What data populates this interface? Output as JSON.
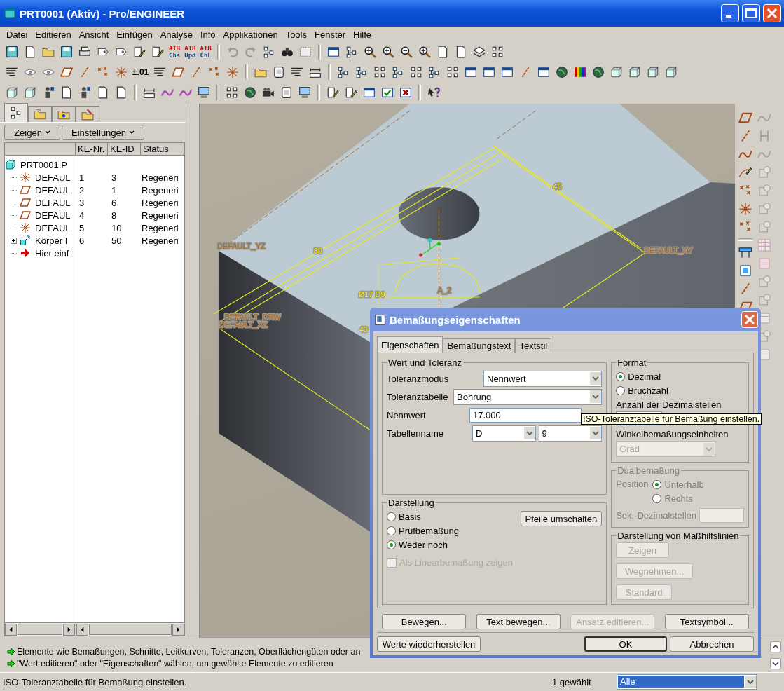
{
  "window": {
    "title": "PRT0001 (Aktiv) - Pro/ENGINEER"
  },
  "menu": [
    "Datei",
    "Editieren",
    "Ansicht",
    "Einfügen",
    "Analyse",
    "Info",
    "Applikationen",
    "Tools",
    "Fenster",
    "Hilfe"
  ],
  "toolbar_labels": [
    {
      "top": "ATB",
      "bottom": "Chs"
    },
    {
      "top": "ATB",
      "bottom": "Upd"
    },
    {
      "top": "ATB",
      "bottom": "ChL"
    },
    {
      "top": "±.01"
    }
  ],
  "model_tree": {
    "tabs": [
      {
        "selected": true
      },
      {
        "selected": false
      },
      {
        "selected": false
      },
      {
        "selected": false
      }
    ],
    "buttons": [
      "Zeigen",
      "Einstellungen"
    ],
    "columns": [
      "KE-Nr.",
      "KE-ID",
      "Status"
    ],
    "root": {
      "name": "PRT0001.P",
      "kind": "part",
      "children": [
        {
          "name": "DEFAUL",
          "kind": "csys",
          "nr": "1",
          "id": "3",
          "status": "Regeneri"
        },
        {
          "name": "DEFAUL",
          "kind": "plane",
          "nr": "2",
          "id": "1",
          "status": "Regeneri"
        },
        {
          "name": "DEFAUL",
          "kind": "plane",
          "nr": "3",
          "id": "6",
          "status": "Regeneri"
        },
        {
          "name": "DEFAUL",
          "kind": "plane",
          "nr": "4",
          "id": "8",
          "status": "Regeneri"
        },
        {
          "name": "DEFAUL",
          "kind": "csys",
          "nr": "5",
          "id": "10",
          "status": "Regeneri"
        },
        {
          "name": "Körper I",
          "kind": "body",
          "nr": "6",
          "id": "50",
          "status": "Regeneri",
          "expanded": false
        },
        {
          "name": "Hier einf",
          "kind": "insert"
        }
      ]
    }
  },
  "viewport": {
    "labels": [
      {
        "text": "DEFAULT_YZ",
        "kind": "datum"
      },
      {
        "text": "80",
        "kind": "dim"
      },
      {
        "text": "45",
        "kind": "dim"
      },
      {
        "text": "DEFAULT_XY",
        "kind": "datum"
      },
      {
        "text": "Ø17 D9",
        "kind": "dim"
      },
      {
        "text": "A_2",
        "kind": "datum"
      },
      {
        "text": "DEFAULT_DRW",
        "kind": "datum"
      },
      {
        "text": "DEFAULT_XZ",
        "kind": "datum"
      },
      {
        "text": "40",
        "kind": "dim"
      }
    ]
  },
  "dialog": {
    "title": "Bemaßungseigenschaften",
    "tabs": [
      {
        "label": "Eigenschaften",
        "selected": true
      },
      {
        "label": "Bemaßungstext",
        "selected": false
      },
      {
        "label": "Textstil",
        "selected": false
      }
    ],
    "value_group": {
      "title": "Wert und Toleranz",
      "fields": [
        {
          "label": "Toleranzmodus",
          "kind": "dropdown",
          "value": "Nennwert"
        },
        {
          "label": "Toleranztabelle",
          "kind": "dropdown-wide",
          "value": "Bohrung"
        },
        {
          "label": "Nennwert",
          "kind": "text",
          "value": "17.000"
        },
        {
          "label": "Tabellenname",
          "kind": "pair",
          "values": [
            "D",
            "9"
          ]
        }
      ]
    },
    "display_group": {
      "title": "Darstellung",
      "options": [
        {
          "label": "Basis",
          "selected": false
        },
        {
          "label": "Prüfbemaßung",
          "selected": false
        },
        {
          "label": "Weder noch",
          "selected": true
        }
      ],
      "button": "Pfeile umschalten",
      "checkbox": {
        "label": "Als Linearbemaßung zeigen",
        "checked": false,
        "disabled": true
      }
    },
    "format_group": {
      "title": "Format",
      "options": [
        {
          "label": "Dezimal",
          "selected": true
        },
        {
          "label": "Bruchzahl",
          "selected": false
        }
      ],
      "decimals_label": "Anzahl der Dezimalstellen",
      "angle_label": "Winkelbemaßungseinheiten",
      "angle_value": "Grad",
      "angle_disabled": true
    },
    "dual_group": {
      "title": "Dualbemaßung",
      "position_label": "Position",
      "options": [
        {
          "label": "Unterhalb",
          "selected": true
        },
        {
          "label": "Rechts",
          "selected": false
        }
      ],
      "decimals_label": "Sek.-Dezimalstellen",
      "disabled": true
    },
    "extension_group": {
      "title": "Darstellung von Maßhilfslinien",
      "buttons": [
        {
          "label": "Zeigen",
          "disabled": true
        },
        {
          "label": "Wegnehmen...",
          "disabled": true
        },
        {
          "label": "Standard",
          "disabled": true
        }
      ]
    },
    "action_buttons": [
      {
        "label": "Bewegen...",
        "disabled": false
      },
      {
        "label": "Text bewegen...",
        "disabled": false
      },
      {
        "label": "Ansatz editieren...",
        "disabled": true
      },
      {
        "label": "Textsymbol...",
        "disabled": false
      }
    ],
    "footer_buttons": [
      {
        "label": "Werte wiederherstellen",
        "default": false
      },
      {
        "label": "OK",
        "default": true
      },
      {
        "label": "Abbrechen",
        "default": false
      }
    ]
  },
  "tooltip": "ISO-Toleranztabelle für Bemaßung einstellen.",
  "messages": [
    "Elemente wie Bemaßungen, Schnitte, Leitkurven, Toleranzen, Oberflächengüten oder an",
    "\"Wert editieren\" oder \"Eigenschaften\" wählen, um gewählte Elemente zu editieren"
  ],
  "status_bar": {
    "text": "ISO-Toleranztabelle für Bemaßung einstellen.",
    "selection": "1 gewählt",
    "filter": "Alle"
  }
}
